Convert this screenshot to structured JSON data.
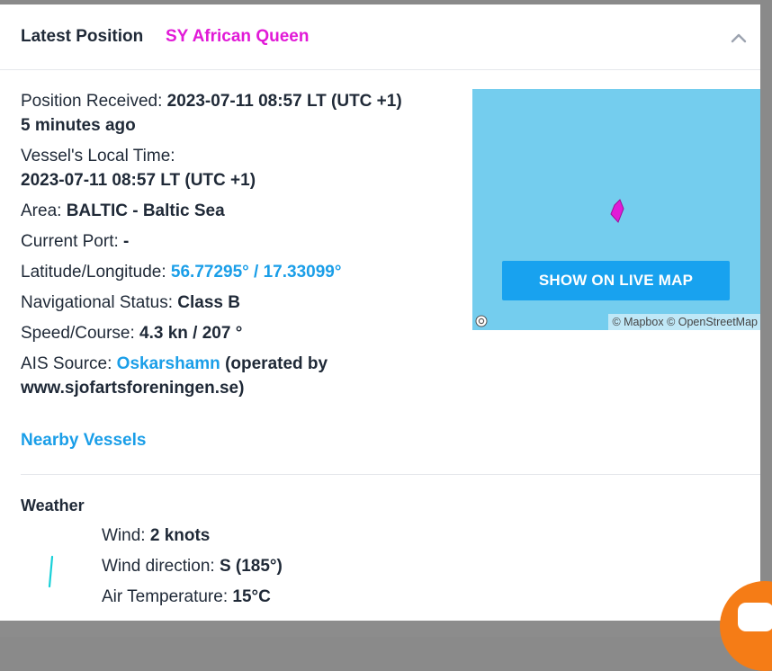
{
  "header": {
    "title": "Latest Position",
    "vessel_name": "SY African Queen"
  },
  "details": {
    "position_received_label": "Position Received:",
    "position_received_value": "2023-07-11 08:57 LT (UTC +1)",
    "position_received_ago": "5 minutes ago",
    "local_time_label": "Vessel's Local Time:",
    "local_time_value": "2023-07-11 08:57 LT (UTC +1)",
    "area_label": "Area:",
    "area_value": "BALTIC - Baltic Sea",
    "current_port_label": "Current Port:",
    "current_port_value": "-",
    "latlon_label": "Latitude/Longitude:",
    "latlon_value": "56.77295° / 17.33099°",
    "nav_status_label": "Navigational Status:",
    "nav_status_value": "Class B",
    "speed_course_label": "Speed/Course:",
    "speed_course_value": "4.3 kn / 207 °",
    "ais_source_label": "AIS Source:",
    "ais_source_link": "Oskarshamn",
    "ais_source_operated": "(operated by",
    "ais_source_operator": "www.sjofartsforeningen.se)"
  },
  "nearby_vessels_label": "Nearby Vessels",
  "map": {
    "button_label": "SHOW ON LIVE MAP",
    "attribution": "© Mapbox © OpenStreetMap",
    "water_color": "#74cdee",
    "vessel_marker_color": "#e11ad7",
    "button_color": "#18a2ef"
  },
  "weather": {
    "title": "Weather",
    "wind_label": "Wind:",
    "wind_value": "2 knots",
    "wind_direction_label": "Wind direction:",
    "wind_direction_value": "S (185°)",
    "air_temp_label": "Air Temperature:",
    "air_temp_value": "15°C",
    "wind_icon_color": "#18d0d8"
  },
  "icons": {
    "collapse": "chevron-up-icon",
    "chat": "chat-icon",
    "vessel": "vessel-marker-icon",
    "wind": "wind-direction-icon",
    "mapbox": "mapbox-logo-icon"
  },
  "colors": {
    "accent_link": "#1a9ee8",
    "vessel_name": "#e11ad7",
    "chat_button": "#f57c16"
  }
}
